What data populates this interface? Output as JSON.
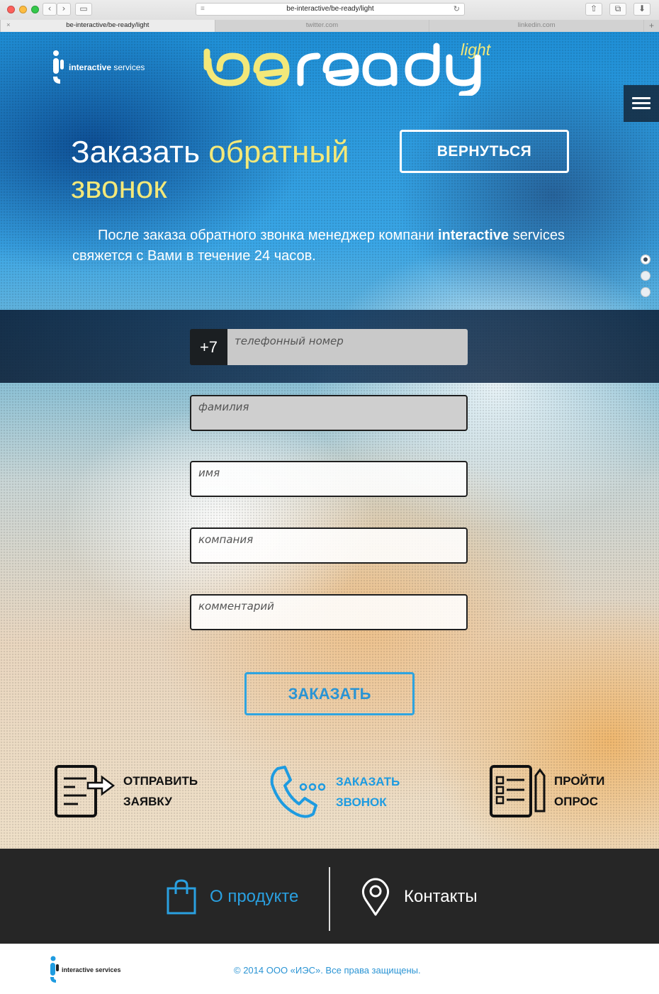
{
  "browser": {
    "url": "be-interactive/be-ready/light",
    "tabs": [
      "be-interactive/be-ready/light",
      "twitter.com",
      "linkedin.com"
    ],
    "new_tab": "+",
    "close_tab": "×"
  },
  "header": {
    "logo_text_bold": "interactive",
    "logo_text_thin": "services",
    "brand_main": "be ready",
    "brand_sub": "light"
  },
  "hero": {
    "title_part1": "Заказать",
    "title_accent": "обратный звонок",
    "back_button": "ВЕРНУТЬСЯ",
    "intro_before": "После заказа обратного звонка менеджер компани",
    "intro_bold": "interactive",
    "intro_after": "services свяжется с Вами в течение 24 часов.",
    "slides": 3,
    "active_slide": 1
  },
  "form": {
    "phone_prefix": "+7",
    "phone_placeholder": "телефонный номер",
    "surname_placeholder": "фамилия",
    "name_placeholder": "имя",
    "company_placeholder": "компания",
    "comment_placeholder": "комментарий",
    "submit": "ЗАКАЗАТЬ"
  },
  "actions": {
    "send_request_l1": "ОТПРАВИТЬ",
    "send_request_l2": "ЗАЯВКУ",
    "callback_l1": "ЗАКАЗАТЬ",
    "callback_l2": "ЗВОНОК",
    "survey_l1": "ПРОЙТИ",
    "survey_l2": "ОПРОС"
  },
  "footer": {
    "product": "О продукте",
    "contacts": "Контакты",
    "copyright": "© 2014 ООО «ИЭС». Все права защищены.",
    "logo_text": "interactive services"
  },
  "colors": {
    "accent_yellow": "#f3e879",
    "accent_blue": "#2a94d4",
    "dark": "#262626"
  }
}
